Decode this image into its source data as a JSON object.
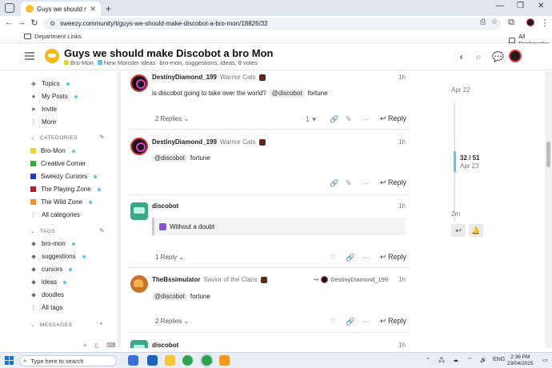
{
  "browser": {
    "tab_title": "Guys we should make Discobo",
    "url": "sweezy.community/t/guys-we-should-make-discobot-a-bro-mon/18826/32",
    "bookmarks": {
      "left": "Department Links",
      "right": "All Bookmarks"
    }
  },
  "topic": {
    "title": "Guys we should make Discobot a bro Mon",
    "category1": "Bro-Mon",
    "category2": "New Monster Ideas",
    "tags_votes": "bro-mon, suggestions, ideas, 8 votes"
  },
  "sidebar": {
    "top": [
      {
        "label": "Topics",
        "icon": "layers-icon"
      },
      {
        "label": "My Posts",
        "icon": "user-icon"
      },
      {
        "label": "Invite",
        "icon": "invite-icon"
      },
      {
        "label": "More",
        "icon": "more-icon"
      }
    ],
    "categories_header": "CATEGORIES",
    "categories": [
      {
        "label": "Bro-Mon",
        "color": "#e8d234"
      },
      {
        "label": "Creative Corner",
        "color": "#3aa83a"
      },
      {
        "label": "Sweezy Cursors",
        "color": "#1f3fbf"
      },
      {
        "label": "The Playing Zone",
        "color": "#a8232a"
      },
      {
        "label": "The Wild Zone",
        "color": "#f0912b"
      }
    ],
    "all_categories": "All categories",
    "tags_header": "TAGS",
    "tags": [
      "bro-mon",
      "suggestions",
      "cursors",
      "ideas",
      "doodles"
    ],
    "all_tags": "All tags",
    "messages_header": "MESSAGES"
  },
  "posts": [
    {
      "username": "DestinyDiamond_199",
      "user_title": "Warrior Cats",
      "date": "1h",
      "body_text": "is discobot going to take over the world?",
      "mention": "@discobot",
      "after_mention": "fortune",
      "replies": "2 Replies",
      "likes": "1",
      "reply_label": "Reply"
    },
    {
      "username": "DestinyDiamond_199",
      "user_title": "Warrior Cats",
      "date": "1h",
      "mention": "@discobot",
      "after_mention": "fortune",
      "reply_label": "Reply"
    },
    {
      "username": "discobot",
      "date": "1h",
      "quote_text": "Without a doubt",
      "replies": "1 Reply",
      "reply_label": "Reply"
    },
    {
      "username": "TheBssimulator",
      "user_title": "Savior of the Clans",
      "reply_to": "DestinyDiamond_199",
      "date": "1h",
      "mention": "@discobot",
      "after_mention": "fortune",
      "replies": "2 Replies",
      "reply_label": "Reply"
    },
    {
      "username": "discobot",
      "date": "1h"
    }
  ],
  "timeline": {
    "start_date": "Apr 22",
    "position": "32 / 51",
    "position_date": "Apr 23",
    "end_label": "2m"
  },
  "taskbar": {
    "search_placeholder": "Type here to search",
    "lang": "ENG",
    "time": "2:36 PM",
    "date": "23/04/2025"
  }
}
